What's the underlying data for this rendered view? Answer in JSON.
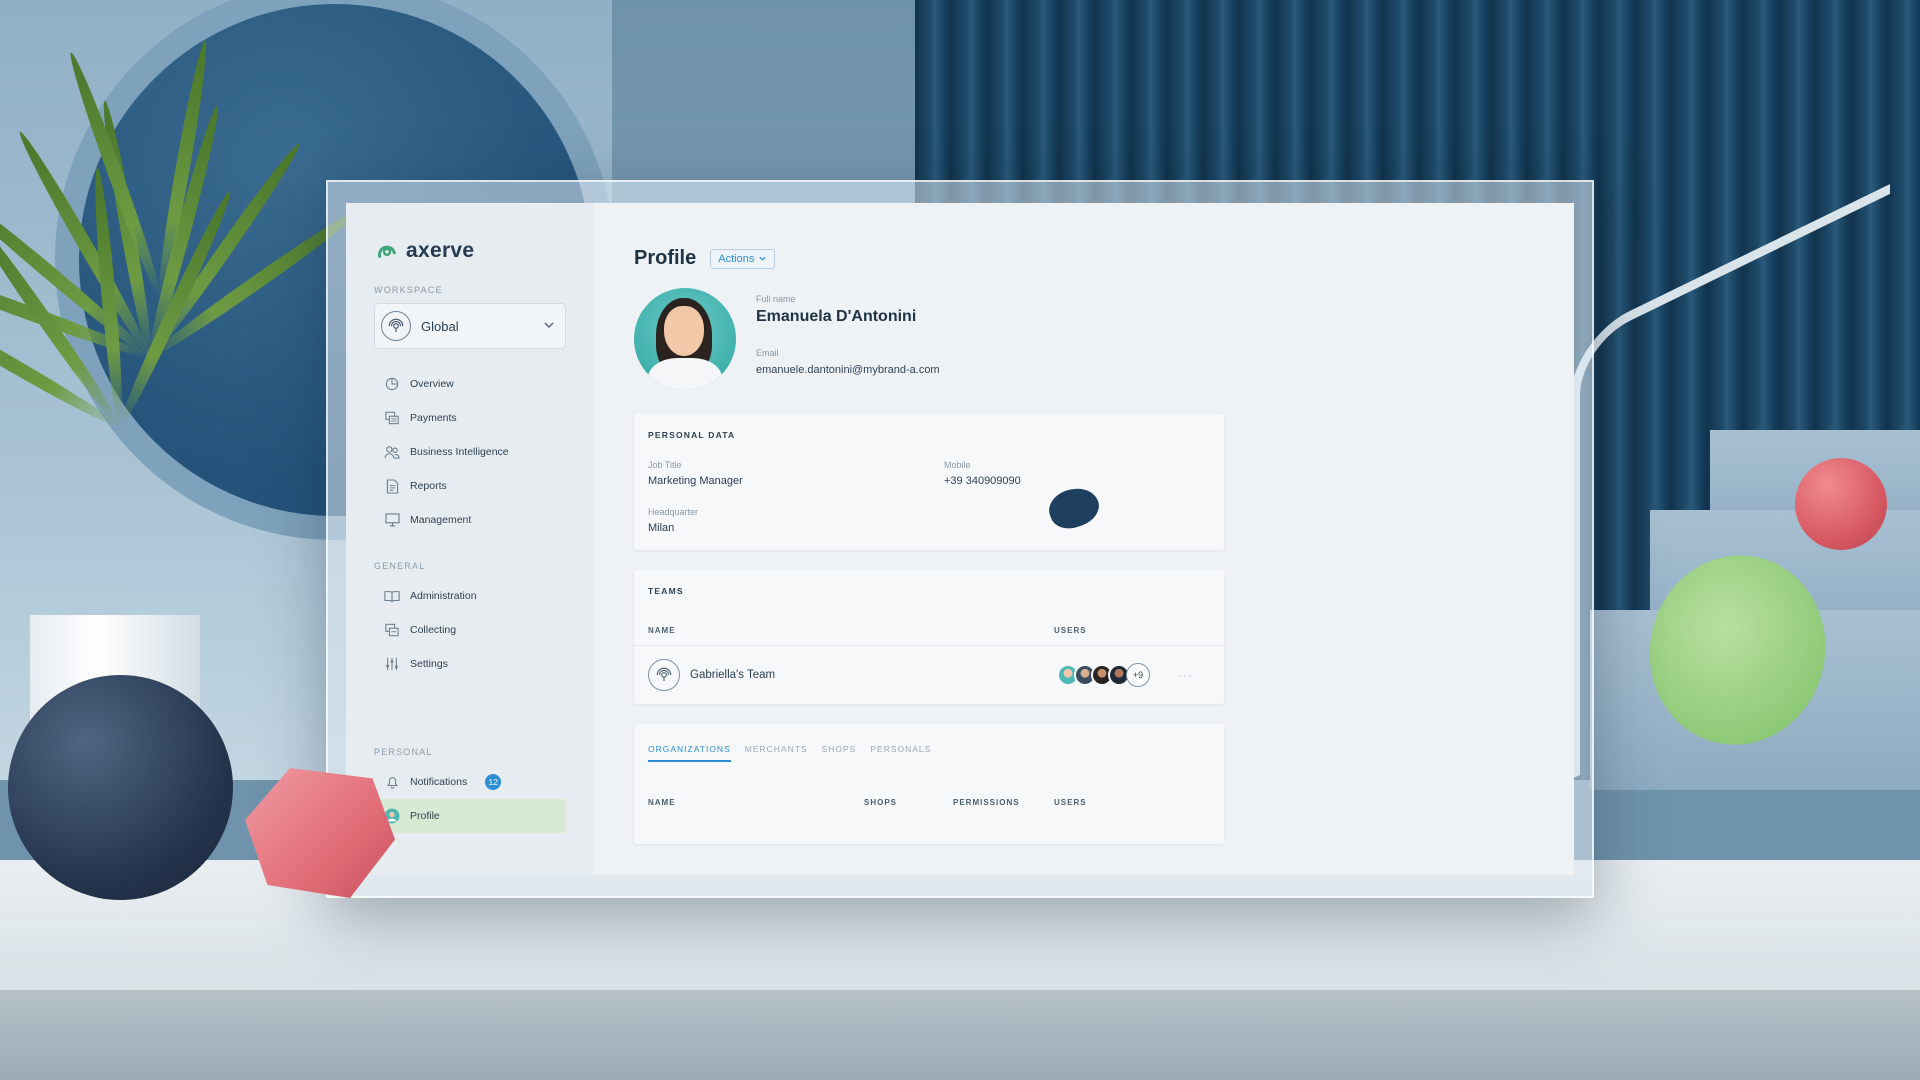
{
  "app": {
    "brand": "axerve"
  },
  "sidebar": {
    "workspace_label": "WORKSPACE",
    "workspace_value": "Global",
    "items": [
      {
        "label": "Overview",
        "icon": "pie-chart-icon"
      },
      {
        "label": "Payments",
        "icon": "payments-icon"
      },
      {
        "label": "Business Intelligence",
        "icon": "users-icon"
      },
      {
        "label": "Reports",
        "icon": "document-icon"
      },
      {
        "label": "Management",
        "icon": "monitor-icon"
      }
    ],
    "general_label": "GENERAL",
    "general_items": [
      {
        "label": "Administration",
        "icon": "book-icon"
      },
      {
        "label": "Collecting",
        "icon": "collecting-icon"
      },
      {
        "label": "Settings",
        "icon": "sliders-icon"
      }
    ],
    "personal_label": "PERSONAL",
    "personal_items": [
      {
        "label": "Notifications",
        "icon": "bell-icon",
        "badge": "12"
      },
      {
        "label": "Profile",
        "icon": "avatar-icon"
      }
    ]
  },
  "main": {
    "title": "Profile",
    "actions_label": "Actions",
    "fullname_label": "Full name",
    "fullname": "Emanuela D'Antonini",
    "email_label": "Email",
    "email": "emanuele.dantonini@mybrand-a.com",
    "personal_data": {
      "title": "PERSONAL DATA",
      "job_title_label": "Job Title",
      "job_title": "Marketing Manager",
      "mobile_label": "Mobile",
      "mobile": "+39 340909090",
      "hq_label": "Headquarter",
      "hq": "Milan"
    },
    "teams": {
      "title": "TEAMS",
      "col_name": "NAME",
      "col_users": "USERS",
      "row_name": "Gabriella's Team",
      "more_users": "+9",
      "menu": "···"
    },
    "tabs": [
      "ORGANIZATIONS",
      "MERCHANTS",
      "SHOPS",
      "PERSONALS"
    ],
    "org_cols": [
      "NAME",
      "SHOPS",
      "PERMISSIONS",
      "USERS"
    ]
  },
  "colors": {
    "accent": "#2c8fd6",
    "active_bg": "#d7ead4",
    "brand_green": "#3fa57a"
  }
}
